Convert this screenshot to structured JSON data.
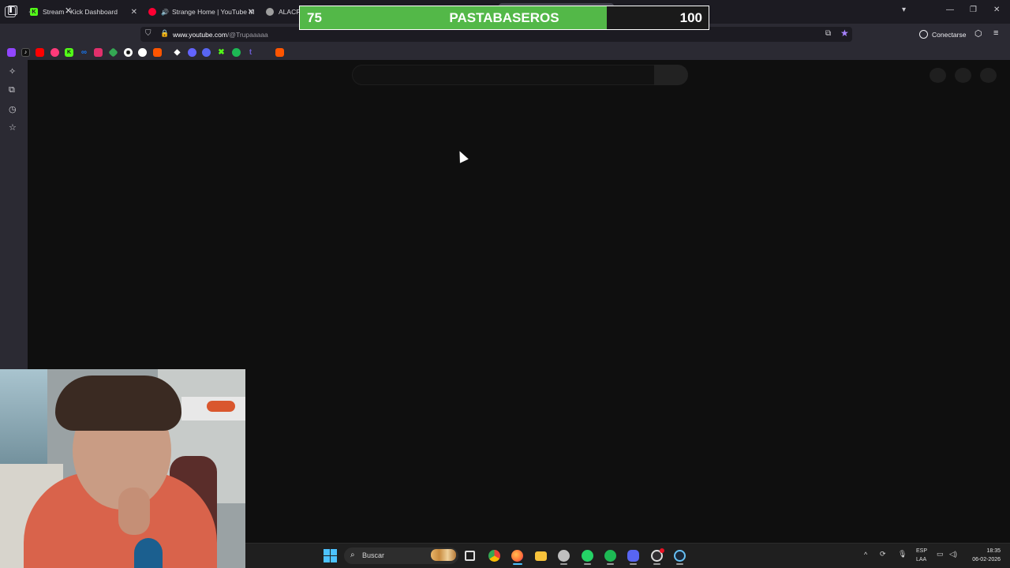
{
  "browser": {
    "tabs": [
      {
        "title": "Stream - Kick Dashboard",
        "icon": "kick-icon",
        "color": "#53fc18"
      },
      {
        "title": "Strange Home | YouTube M",
        "icon": "youtube-music-icon",
        "color": "#ff0033"
      },
      {
        "title": "ALACRA",
        "icon": "chrome-icon",
        "color": "#9e9e9e"
      }
    ],
    "url_host": "www.youtube.com",
    "url_path": "/@Trupaaaaa",
    "account_label": "Conectarse",
    "accent_color": "#a783ff"
  },
  "bookmarks": [
    {
      "icon": "twitch-icon",
      "color": "#9146ff"
    },
    {
      "icon": "tiktok-icon",
      "color": "#111111"
    },
    {
      "icon": "youtube-icon",
      "color": "#ff0000"
    },
    {
      "icon": "music-icon",
      "color": "#ff3a7a"
    },
    {
      "icon": "kick-icon",
      "color": "#53fc18"
    },
    {
      "icon": "meta-icon",
      "color": "#1877f2"
    },
    {
      "icon": "instagram-icon",
      "color": "#e1306c"
    },
    {
      "icon": "drive-icon",
      "color": "#34a853"
    },
    {
      "icon": "openai-icon",
      "color": "#ffffff"
    },
    {
      "icon": "github-icon",
      "color": "#ffffff"
    },
    {
      "icon": "soundcloud-icon",
      "color": "#ff5500"
    },
    {
      "icon": "diamond-icon",
      "color": "#ffffff"
    },
    {
      "icon": "mastodon-icon",
      "color": "#6364ff"
    },
    {
      "icon": "chat-icon",
      "color": "#5865f2"
    },
    {
      "icon": "xbox-icon",
      "color": "#107c10"
    },
    {
      "icon": "spotify-icon",
      "color": "#1db954"
    },
    {
      "icon": "tumblr-icon",
      "color": "#6a5acd"
    },
    {
      "icon": "twitter-icon",
      "color": "#1d9bf0"
    },
    {
      "icon": "soundcloud-icon",
      "color": "#ff5500"
    }
  ],
  "goal": {
    "current": "75",
    "title": "PASTABASEROS",
    "target": "100",
    "progress": 0.75,
    "fill_color": "#53b848"
  },
  "taskbar": {
    "search_label": "Buscar",
    "apps": [
      {
        "icon": "task-view-icon",
        "color": "#e0e0e0"
      },
      {
        "icon": "chrome-icon",
        "color": "#e8453c"
      },
      {
        "icon": "firefox-icon",
        "color": "#ff7139"
      },
      {
        "icon": "file-explorer-icon",
        "color": "#f8c33b"
      },
      {
        "icon": "settings-icon",
        "color": "#bfbfbf"
      },
      {
        "icon": "whatsapp-icon",
        "color": "#25d366"
      },
      {
        "icon": "spotify-icon",
        "color": "#1db954"
      },
      {
        "icon": "discord-icon",
        "color": "#5865f2"
      },
      {
        "icon": "obs-icon",
        "color": "#302e31"
      },
      {
        "icon": "steam-icon",
        "color": "#1b2838"
      }
    ],
    "lang_line1": "ESP",
    "lang_line2": "LAA",
    "time": "18:35",
    "date": "06-02-2026"
  }
}
